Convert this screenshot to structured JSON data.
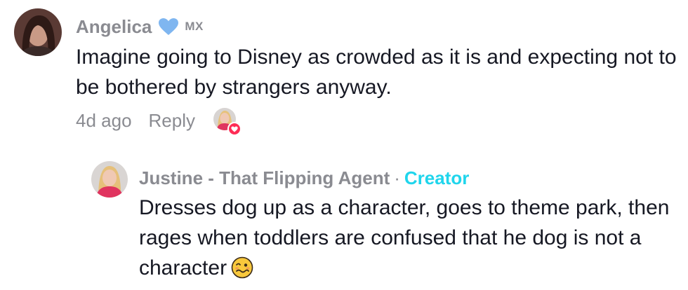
{
  "colors": {
    "muted": "#8a8b91",
    "text": "#161823",
    "creator": "#20d5ec",
    "heart_badge": "#7fb6f0",
    "like_heart": "#fe2c55"
  },
  "comments": [
    {
      "username": "Angelica",
      "badge_icon": "blue-heart-icon",
      "country": "MX",
      "text": "Imagine going to Disney as crowded as it is and expecting not to be bothered by strangers anyway.",
      "time": "4d ago",
      "reply_label": "Reply",
      "liked_by_creator_icon": "creator-liked-heart-icon"
    },
    {
      "username": "Justine - That Flipping Agent",
      "separator": "·",
      "role": "Creator",
      "text": "Dresses dog up as a character, goes to theme park, then rages when toddlers are confused that he dog is not a character",
      "emoji_icon": "woozy-face-emoji"
    }
  ]
}
